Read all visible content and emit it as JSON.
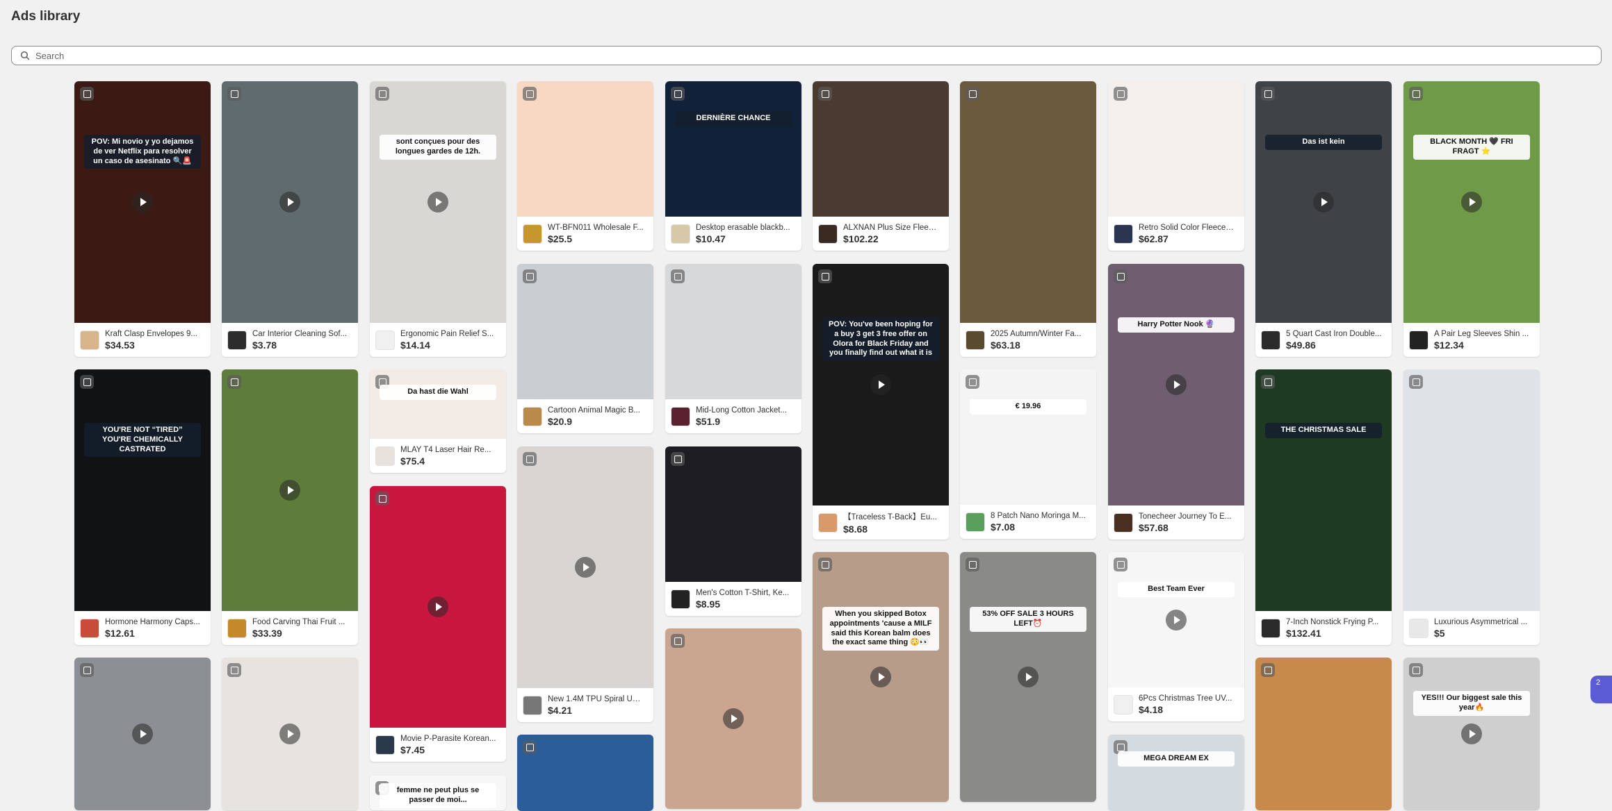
{
  "header": {
    "title": "Ads library"
  },
  "search": {
    "placeholder": "Search",
    "value": ""
  },
  "chat_badge": "2",
  "cards": [
    {
      "name": "Kraft Clasp Envelopes 9...",
      "price": "$34.53",
      "video": true,
      "overlay": "POV: Mi novio y yo dejamos de ver Netflix para resolver un caso de asesinato 🔍🚨",
      "media_color": "#3a1a12",
      "thumb_color": "#d8b48a"
    },
    {
      "name": "Hormone Harmony Caps...",
      "price": "$12.61",
      "video": false,
      "overlay": "YOU'RE NOT “TIRED” YOU'RE CHEMICALLY CASTRATED",
      "media_color": "#111214",
      "thumb_color": "#c94b3a"
    },
    {
      "name": "",
      "price": "",
      "video": true,
      "overlay": "",
      "media_color": "#8c8f93",
      "thumb_color": "#888"
    },
    {
      "name": "Car Interior Cleaning Sof...",
      "price": "$3.78",
      "video": true,
      "overlay": "",
      "media_color": "#5f6b6e",
      "thumb_color": "#2d2d2d"
    },
    {
      "name": "Food Carving Thai Fruit ...",
      "price": "$33.39",
      "video": true,
      "overlay": "",
      "media_color": "#5f7d3a",
      "thumb_color": "#c48a2a"
    },
    {
      "name": "",
      "price": "",
      "video": true,
      "overlay": "",
      "media_color": "#e7e4e0",
      "thumb_color": "#888"
    },
    {
      "name": "Ergonomic Pain Relief S...",
      "price": "$14.14",
      "video": true,
      "overlay": "sont conçues pour des longues gardes de 12h.",
      "media_color": "#d9d7d4",
      "thumb_color": "#f0f0f0"
    },
    {
      "name": "MLAY T4 Laser Hair Re...",
      "price": "$75.4",
      "video": false,
      "overlay": "Da hast die Wahl",
      "media_color": "#f3ebe6",
      "thumb_color": "#e9e2dc"
    },
    {
      "name": "Movie P-Parasite Korean...",
      "price": "$7.45",
      "video": true,
      "overlay": "",
      "media_color": "#c9163f",
      "thumb_color": "#2a3a4a"
    },
    {
      "name": "",
      "price": "",
      "video": false,
      "overlay": "femme ne peut plus se passer de moi...",
      "media_color": "#f7f7f7",
      "thumb_color": "#888"
    },
    {
      "name": "WT-BFN011 Wholesale F...",
      "price": "$25.5",
      "video": false,
      "overlay": "",
      "media_color": "#f7d8c2",
      "thumb_color": "#c8962e"
    },
    {
      "name": "Cartoon Animal Magic B...",
      "price": "$20.9",
      "video": false,
      "overlay": "",
      "media_color": "#c9ced3",
      "thumb_color": "#b98a4a"
    },
    {
      "name": "New 1.4M TPU Spiral US...",
      "price": "$4.21",
      "video": true,
      "overlay": "",
      "media_color": "#d8d5d3",
      "thumb_color": "#777"
    },
    {
      "name": "",
      "price": "",
      "video": false,
      "overlay": "",
      "media_color": "#2a5d9a",
      "thumb_color": "#888"
    },
    {
      "name": "Desktop erasable blackb...",
      "price": "$10.47",
      "video": false,
      "overlay": "DERNIÈRE CHANCE",
      "media_color": "#12213a",
      "thumb_color": "#d7c9a8"
    },
    {
      "name": "Mid-Long Cotton Jacket...",
      "price": "$51.9",
      "video": false,
      "overlay": "",
      "media_color": "#d6d8da",
      "thumb_color": "#5a2230"
    },
    {
      "name": "Men's Cotton T-Shirt, Ke...",
      "price": "$8.95",
      "video": false,
      "overlay": "",
      "media_color": "#1d1d22",
      "thumb_color": "#222"
    },
    {
      "name": "",
      "price": "",
      "video": true,
      "overlay": "",
      "media_color": "#caa58f",
      "thumb_color": "#888"
    },
    {
      "name": "ALXNAN Plus Size Fleec...",
      "price": "$102.22",
      "video": false,
      "overlay": "",
      "media_color": "#4a3a30",
      "thumb_color": "#3a2a22"
    },
    {
      "name": "【Traceless T-Back】Eu...",
      "price": "$8.68",
      "video": true,
      "overlay": "POV: You've been hoping for a buy 3 get 3 free offer on Olora for Black Friday and you finally find out what it is",
      "media_color": "#1a1a1a",
      "thumb_color": "#d89a6a"
    },
    {
      "name": "",
      "price": "",
      "video": true,
      "overlay": "When you skipped Botox appointments 'cause a MILF said this Korean balm does the exact same thing 😳👀",
      "media_color": "#b79c8a",
      "thumb_color": "#888"
    },
    {
      "name": "2025 Autumn/Winter Fa...",
      "price": "$63.18",
      "video": false,
      "overlay": "",
      "media_color": "#6b5a3c",
      "thumb_color": "#5a4a30"
    },
    {
      "name": "8 Patch Nano Moringa M...",
      "price": "$7.08",
      "video": false,
      "overlay": "€ 19.96",
      "media_color": "#f4f4f4",
      "thumb_color": "#5aa05a"
    },
    {
      "name": "",
      "price": "",
      "video": true,
      "overlay": "53% OFF SALE 3 HOURS LEFT⏰",
      "media_color": "#8a8a88",
      "thumb_color": "#888"
    },
    {
      "name": "Retro Solid Color Fleece ...",
      "price": "$62.87",
      "video": false,
      "overlay": "",
      "media_color": "#f2efec",
      "thumb_color": "#2a3550"
    },
    {
      "name": "Tonecheer Journey To E...",
      "price": "$57.68",
      "video": true,
      "overlay": "Harry Potter Nook 🔮",
      "media_color": "#6e5e70",
      "thumb_color": "#4a3020"
    },
    {
      "name": "6Pcs Christmas Tree UV...",
      "price": "$4.18",
      "video": true,
      "overlay": "Best Team Ever",
      "media_color": "#f6f6f6",
      "thumb_color": "#f0f0f0"
    },
    {
      "name": "",
      "price": "",
      "video": false,
      "overlay": "MEGA DREAM EX",
      "media_color": "#d4dbe0",
      "thumb_color": "#888"
    },
    {
      "name": "5 Quart Cast Iron Double...",
      "price": "$49.86",
      "video": true,
      "overlay": "Das ist kein",
      "media_color": "#3f4246",
      "thumb_color": "#2a2a2a"
    },
    {
      "name": "7-Inch Nonstick Frying P...",
      "price": "$132.41",
      "video": false,
      "overlay": "THE CHRISTMAS SALE",
      "media_color": "#1f3a22",
      "thumb_color": "#2a2a2a"
    },
    {
      "name": "",
      "price": "",
      "video": false,
      "overlay": "",
      "media_color": "#c88a4a",
      "thumb_color": "#888"
    },
    {
      "name": "A Pair Leg Sleeves Shin ...",
      "price": "$12.34",
      "video": true,
      "overlay": "BLACK MONTH 🖤 FRI FRAGT ⭐",
      "media_color": "#6f9a48",
      "thumb_color": "#222"
    },
    {
      "name": "Luxurious Asymmetrical ...",
      "price": "$5",
      "video": false,
      "overlay": "",
      "media_color": "#dfe2e6",
      "thumb_color": "#e8e8e8"
    },
    {
      "name": "",
      "price": "",
      "video": true,
      "overlay": "YES!!! Our biggest sale this year🔥",
      "media_color": "#cfcfcf",
      "thumb_color": "#888"
    }
  ]
}
